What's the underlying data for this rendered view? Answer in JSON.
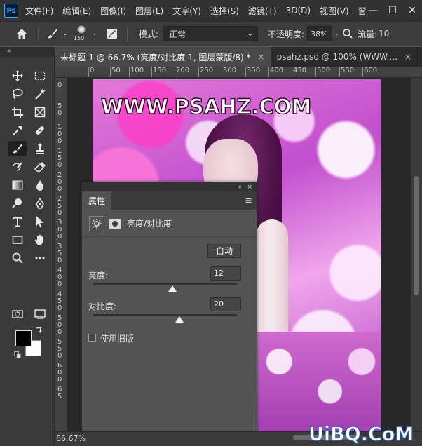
{
  "menubar": {
    "logo": "Ps",
    "items": [
      "文件(F)",
      "编辑(E)",
      "图像(I)",
      "图层(L)",
      "文字(Y)",
      "选择(S)",
      "滤镜(T)",
      "3D(D)",
      "视图(V)",
      "窗"
    ],
    "minimize": "—",
    "maximize": "☐",
    "close": "✕"
  },
  "options": {
    "brush_size": "150",
    "mode_label": "模式:",
    "mode_value": "正常",
    "opacity_label": "不透明度:",
    "opacity_value": "38%",
    "flow_label": "流量:",
    "flow_value": "10"
  },
  "tabs": [
    {
      "label": "未标题-1 @ 66.7% (亮度/对比度 1, 图层蒙版/8) *",
      "close": "×"
    },
    {
      "label": "psahz.psd @ 100% (WWW....",
      "close": "×"
    }
  ],
  "panel_collapse": "«",
  "ruler": {
    "h_ticks": [
      "0",
      "50",
      "100",
      "150",
      "200",
      "250",
      "300",
      "350",
      "400",
      "450",
      "500",
      "550",
      "600"
    ],
    "v_ticks": [
      "0",
      "5",
      "0",
      "1",
      "0",
      "0",
      "1",
      "5",
      "0",
      "2",
      "0",
      "0",
      "2",
      "5",
      "0",
      "3",
      "0",
      "0",
      "3",
      "5",
      "0",
      "4",
      "0",
      "0",
      "4",
      "5",
      "0",
      "5",
      "0",
      "0",
      "5",
      "5",
      "0",
      "6",
      "0",
      "0",
      "6",
      "5"
    ]
  },
  "canvas": {
    "watermark": "WWW.PSAHZ.COM"
  },
  "properties": {
    "panel_top_collapse": "«",
    "panel_top_close": "×",
    "tab": "属性",
    "menu": "≡",
    "subtitle": "亮度/对比度",
    "auto_label": "自动",
    "brightness_label": "亮度:",
    "brightness_value": "12",
    "brightness_level": 0.55,
    "contrast_label": "对比度:",
    "contrast_value": "20",
    "contrast_level": 0.6,
    "legacy_label": "使用旧版"
  },
  "status": {
    "zoom": "66.67%"
  },
  "site_watermark": "UiBQ.CoM",
  "colors": {
    "foreground": "#000000",
    "background": "#ffffff",
    "accent": "#31a8ff"
  }
}
